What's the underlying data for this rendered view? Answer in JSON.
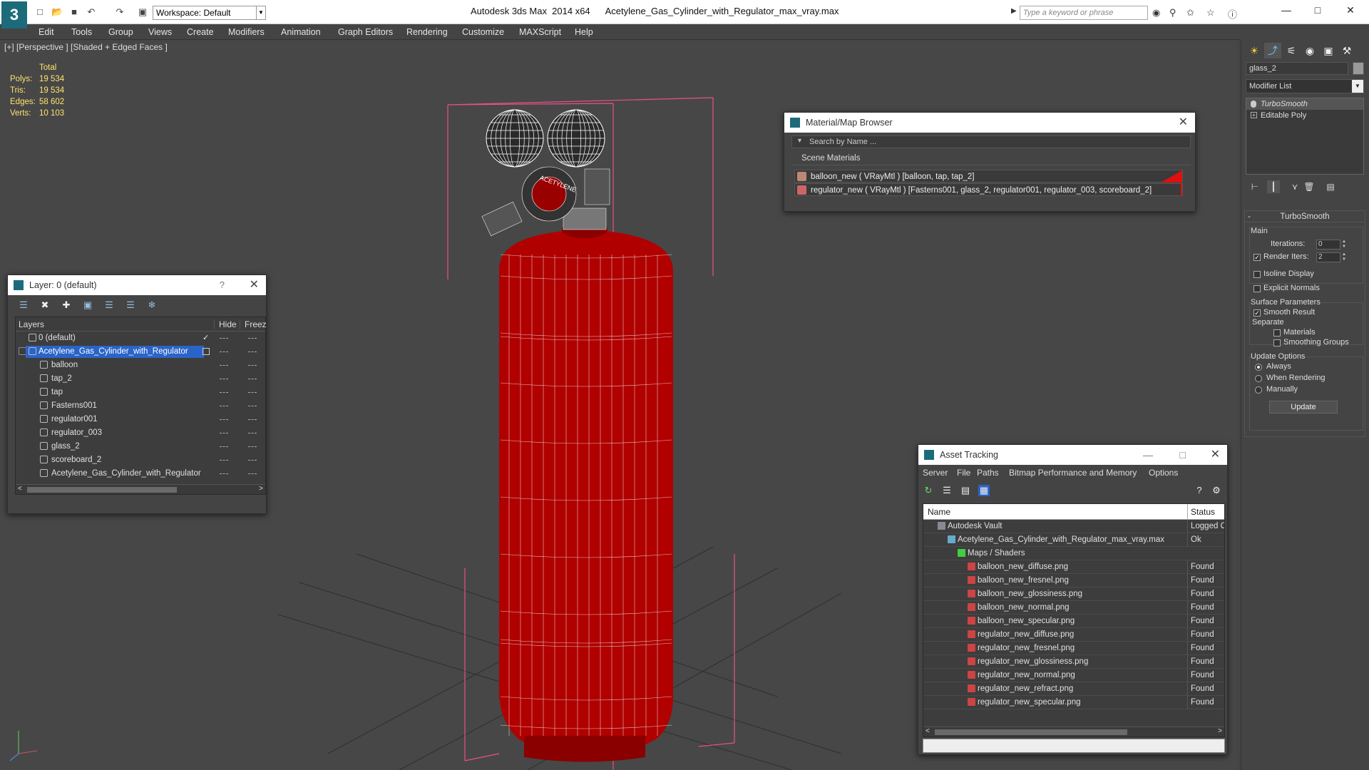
{
  "titlebar": {
    "app": "Autodesk 3ds Max  2014 x64",
    "file": "Acetylene_Gas_Cylinder_with_Regulator_max_vray.max",
    "workspace": "Workspace: Default",
    "search_placeholder": "Type a keyword or phrase"
  },
  "menus": [
    "Edit",
    "Tools",
    "Group",
    "Views",
    "Create",
    "Modifiers",
    "Animation",
    "Graph Editors",
    "Rendering",
    "Customize",
    "MAXScript",
    "Help"
  ],
  "viewport": {
    "label": "[+] [Perspective ] [Shaded + Edged Faces ]",
    "stats": {
      "header": "Total",
      "rows": [
        {
          "k": "Polys:",
          "v": "19 534"
        },
        {
          "k": "Tris:",
          "v": "19 534"
        },
        {
          "k": "Edges:",
          "v": "58 602"
        },
        {
          "k": "Verts:",
          "v": "10 103"
        }
      ]
    },
    "cylinder_color": "#b00000",
    "wire_color": "#ffffff",
    "selection_color": "#e8508a",
    "gauge_label": "ACETYLENE"
  },
  "layer_dialog": {
    "title": "Layer: 0 (default)",
    "help": "?",
    "col_layers": "Layers",
    "col_hide": "Hide",
    "col_freeze": "Freez",
    "rows": [
      {
        "name": "0 (default)",
        "indent": 0,
        "current": true,
        "selected": false
      },
      {
        "name": "Acetylene_Gas_Cylinder_with_Regulator",
        "indent": 0,
        "current": false,
        "selected": true
      },
      {
        "name": "balloon",
        "indent": 1
      },
      {
        "name": "tap_2",
        "indent": 1
      },
      {
        "name": "tap",
        "indent": 1
      },
      {
        "name": "Fasterns001",
        "indent": 1
      },
      {
        "name": "regulator001",
        "indent": 1
      },
      {
        "name": "regulator_003",
        "indent": 1
      },
      {
        "name": "glass_2",
        "indent": 1
      },
      {
        "name": "scoreboard_2",
        "indent": 1
      },
      {
        "name": "Acetylene_Gas_Cylinder_with_Regulator",
        "indent": 1
      }
    ]
  },
  "material_browser": {
    "title": "Material/Map Browser",
    "search_placeholder": "Search by Name ...",
    "section": "Scene Materials",
    "rows": [
      "balloon_new  ( VRayMtl )  [balloon, tap, tap_2]",
      "regulator_new  ( VRayMtl )  [Fasterns001, glass_2, regulator001, regulator_003, scoreboard_2]"
    ]
  },
  "asset_tracking": {
    "title": "Asset Tracking",
    "menu": [
      "Server",
      "File",
      "Paths",
      "Bitmap Performance and Memory",
      "Options"
    ],
    "col_name": "Name",
    "col_status": "Status",
    "rows": [
      {
        "name": "Autodesk Vault",
        "status": "Logged O",
        "indent": 0
      },
      {
        "name": "Acetylene_Gas_Cylinder_with_Regulator_max_vray.max",
        "status": "Ok",
        "indent": 1
      },
      {
        "name": "Maps / Shaders",
        "status": "",
        "indent": 2
      },
      {
        "name": "balloon_new_diffuse.png",
        "status": "Found",
        "indent": 3
      },
      {
        "name": "balloon_new_fresnel.png",
        "status": "Found",
        "indent": 3
      },
      {
        "name": "balloon_new_glossiness.png",
        "status": "Found",
        "indent": 3
      },
      {
        "name": "balloon_new_normal.png",
        "status": "Found",
        "indent": 3
      },
      {
        "name": "balloon_new_specular.png",
        "status": "Found",
        "indent": 3
      },
      {
        "name": "regulator_new_diffuse.png",
        "status": "Found",
        "indent": 3
      },
      {
        "name": "regulator_new_fresnel.png",
        "status": "Found",
        "indent": 3
      },
      {
        "name": "regulator_new_glossiness.png",
        "status": "Found",
        "indent": 3
      },
      {
        "name": "regulator_new_normal.png",
        "status": "Found",
        "indent": 3
      },
      {
        "name": "regulator_new_refract.png",
        "status": "Found",
        "indent": 3
      },
      {
        "name": "regulator_new_specular.png",
        "status": "Found",
        "indent": 3
      }
    ]
  },
  "command_panel": {
    "object_name": "glass_2",
    "modifier_list": "Modifier List",
    "stack": [
      "TurboSmooth",
      "Editable Poly"
    ],
    "turbosmooth": {
      "title": "TurboSmooth",
      "main": "Main",
      "iterations_label": "Iterations:",
      "iterations": "0",
      "render_iters_label": "Render Iters:",
      "render_iters": "2",
      "isoline": "Isoline Display",
      "explicit_normals": "Explicit Normals",
      "surface_params": "Surface Parameters",
      "smooth_result": "Smooth Result",
      "separate": "Separate",
      "materials": "Materials",
      "smoothing_groups": "Smoothing Groups",
      "update_options": "Update Options",
      "always": "Always",
      "when_rendering": "When Rendering",
      "manually": "Manually",
      "update_btn": "Update"
    }
  }
}
